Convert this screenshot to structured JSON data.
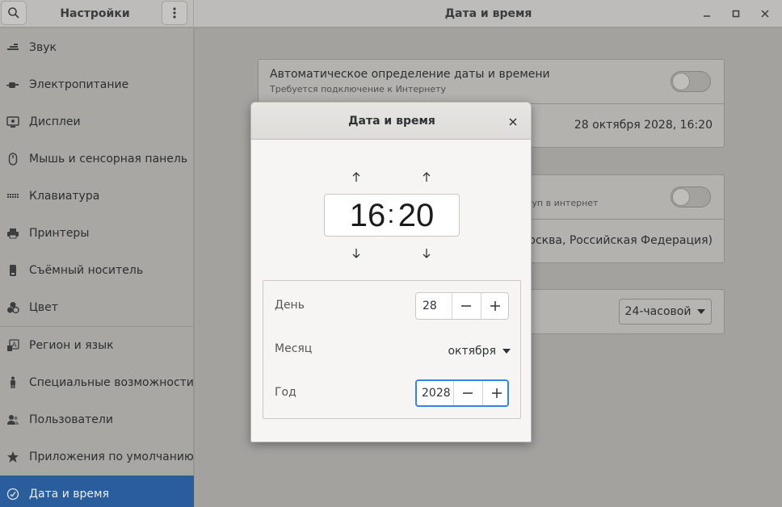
{
  "header": {
    "settings_title": "Настройки",
    "window_title": "Дата и время",
    "search_icon": "search-icon",
    "menu_icon": "more-vertical-icon"
  },
  "sidebar": {
    "items": [
      {
        "label": "Звук",
        "icon": "speaker-icon"
      },
      {
        "label": "Электропитание",
        "icon": "power-plug-icon"
      },
      {
        "label": "Дисплеи",
        "icon": "display-icon"
      },
      {
        "label": "Мышь и сенсорная панель",
        "icon": "mouse-icon"
      },
      {
        "label": "Клавиатура",
        "icon": "keyboard-icon"
      },
      {
        "label": "Принтеры",
        "icon": "printer-icon"
      },
      {
        "label": "Съёмный носитель",
        "icon": "usb-drive-icon"
      },
      {
        "label": "Цвет",
        "icon": "color-icon"
      },
      {
        "label": "Регион и язык",
        "icon": "language-icon"
      },
      {
        "label": "Специальные возможности",
        "icon": "accessibility-icon"
      },
      {
        "label": "Пользователи",
        "icon": "users-icon"
      },
      {
        "label": "Приложения по умолчанию",
        "icon": "star-icon"
      },
      {
        "label": "Дата и время",
        "icon": "clock-icon"
      }
    ],
    "active_index": 12
  },
  "main": {
    "auto_datetime_title": "Автоматическое определение даты и времени",
    "auto_datetime_subtitle": "Требуется подключение к Интернету",
    "current_datetime": "28 октября 2028, 16:20",
    "auto_timezone_partial": "туп в интернет",
    "timezone_partial": "Москва, Российская Федерация)",
    "time_format": "24-часовой"
  },
  "dialog": {
    "title": "Дата и время",
    "hours": "16",
    "separator": ":",
    "minutes": "20",
    "day_label": "День",
    "day_value": "28",
    "month_label": "Месяц",
    "month_value": "октября",
    "year_label": "Год",
    "year_value": "2028"
  },
  "colors": {
    "accent": "#3584e4",
    "sidebar_active": "#2a5d9c",
    "dialog_bg": "#f6f5f4"
  }
}
